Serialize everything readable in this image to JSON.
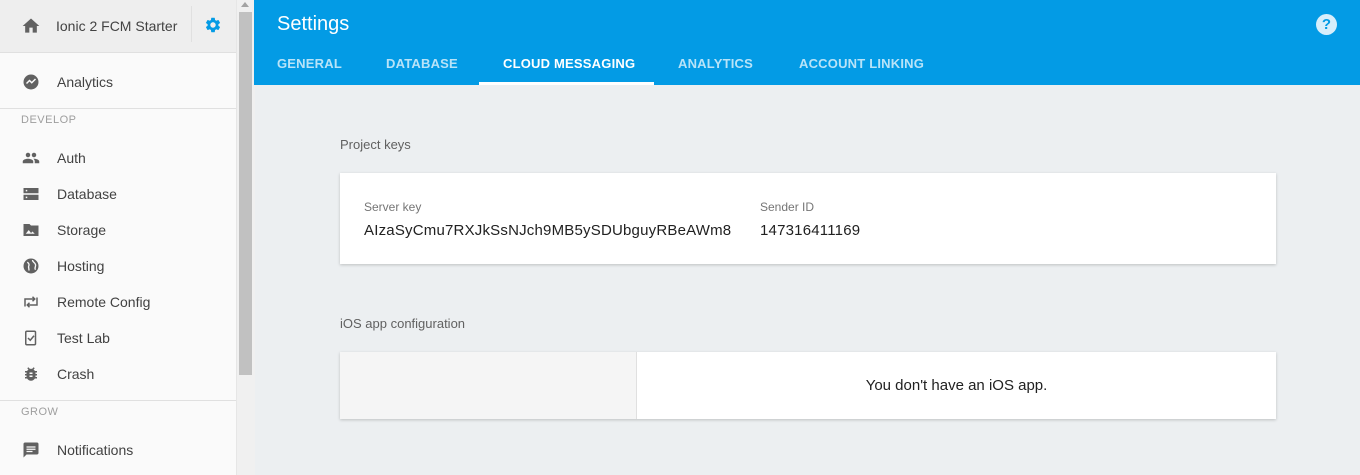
{
  "sidebar": {
    "project_name": "Ionic 2 FCM Starter",
    "analytics_label": "Analytics",
    "develop_header": "DEVELOP",
    "develop_items": [
      {
        "label": "Auth",
        "icon": "people-icon"
      },
      {
        "label": "Database",
        "icon": "database-icon"
      },
      {
        "label": "Storage",
        "icon": "storage-icon"
      },
      {
        "label": "Hosting",
        "icon": "globe-icon"
      },
      {
        "label": "Remote Config",
        "icon": "remote-config-icon"
      },
      {
        "label": "Test Lab",
        "icon": "test-lab-icon"
      },
      {
        "label": "Crash",
        "icon": "bug-icon"
      }
    ],
    "grow_header": "GROW",
    "grow_items": [
      {
        "label": "Notifications",
        "icon": "notifications-icon"
      }
    ]
  },
  "header": {
    "title": "Settings",
    "tabs": [
      {
        "label": "GENERAL",
        "active": false
      },
      {
        "label": "DATABASE",
        "active": false
      },
      {
        "label": "CLOUD MESSAGING",
        "active": true
      },
      {
        "label": "ANALYTICS",
        "active": false
      },
      {
        "label": "ACCOUNT LINKING",
        "active": false
      }
    ],
    "help_symbol": "?"
  },
  "project_keys": {
    "section_title": "Project keys",
    "server_key_label": "Server key",
    "server_key_value": "AIzaSyCmu7RXJkSsNJch9MB5ySDUbguyRBeAWm8",
    "sender_id_label": "Sender ID",
    "sender_id_value": "147316411169"
  },
  "ios_config": {
    "section_title": "iOS app configuration",
    "message": "You don't have an iOS app."
  },
  "colors": {
    "header_bg": "#039be5",
    "sidebar_bg": "#fafafa",
    "content_bg": "#eceff1",
    "icon_gray": "#616161",
    "gear_blue": "#039be5"
  }
}
